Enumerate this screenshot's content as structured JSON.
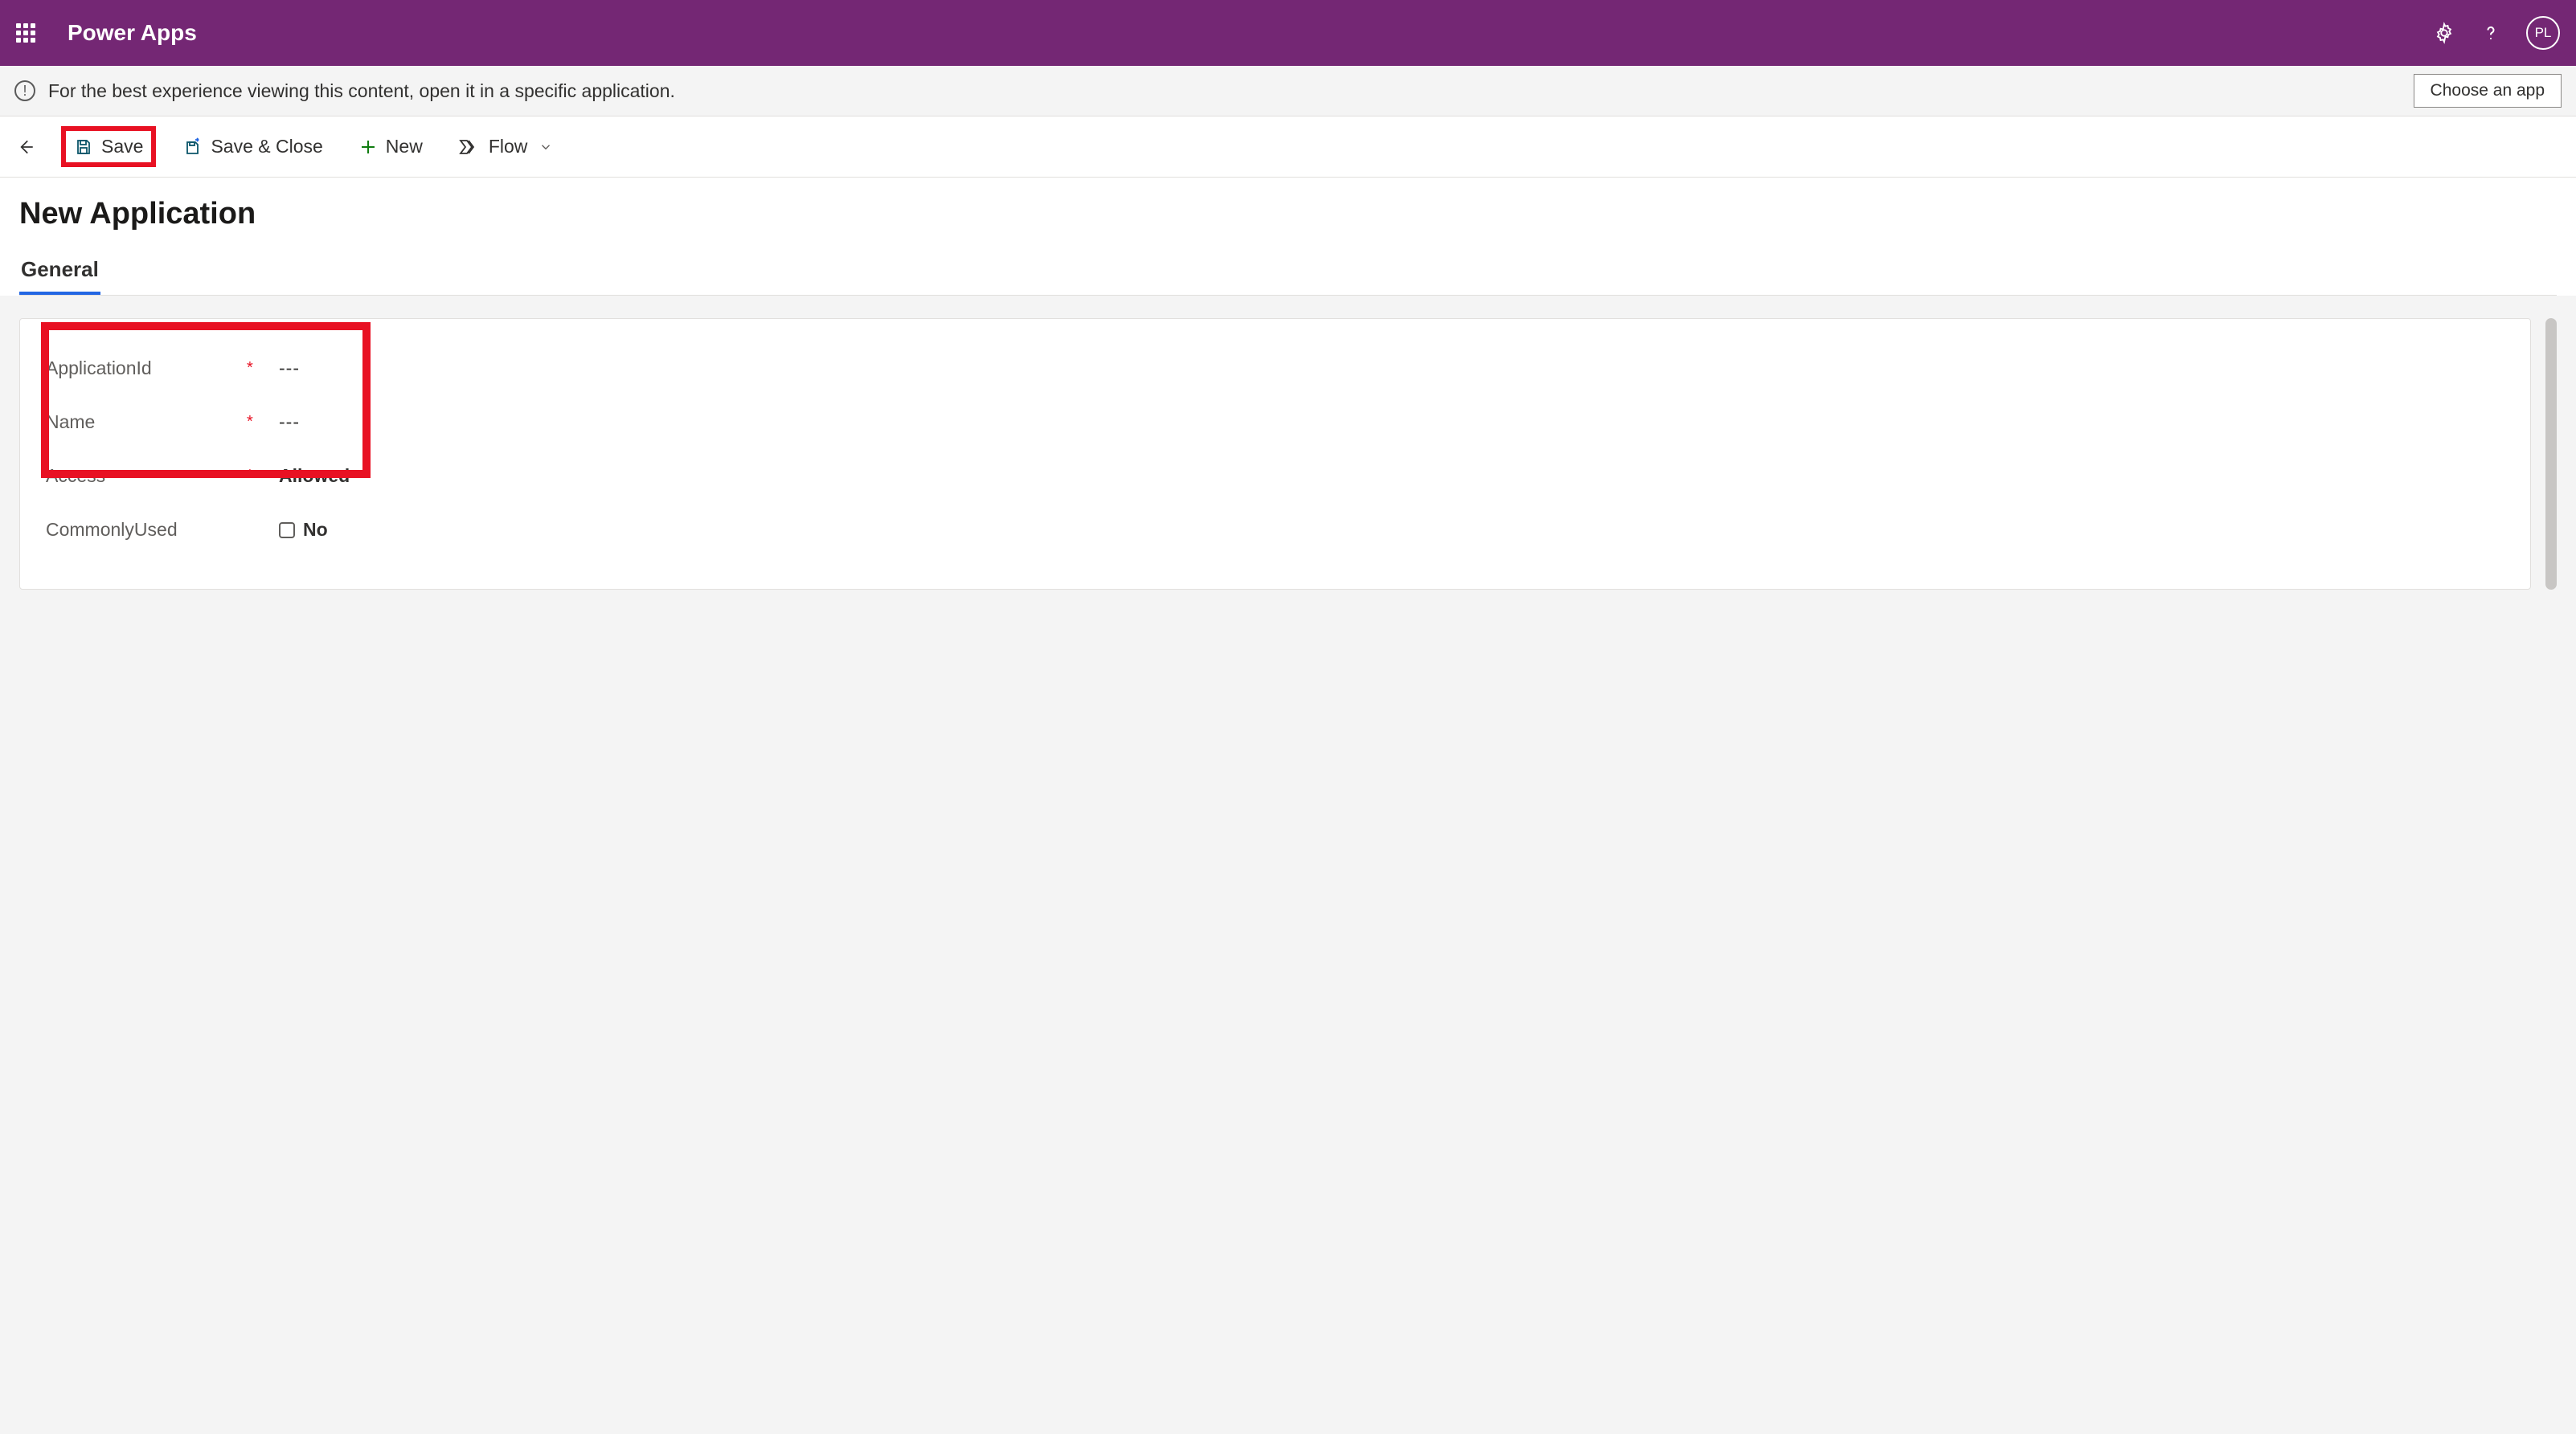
{
  "header": {
    "brand": "Power Apps",
    "avatar_initials": "PL"
  },
  "notice": {
    "text": "For the best experience viewing this content, open it in a specific application.",
    "button_label": "Choose an app"
  },
  "commands": {
    "save": "Save",
    "save_close": "Save & Close",
    "new": "New",
    "flow": "Flow"
  },
  "page": {
    "title": "New Application",
    "tabs": [
      {
        "label": "General",
        "active": true
      }
    ]
  },
  "form": {
    "fields": [
      {
        "label": "ApplicationId",
        "required": true,
        "value": "---",
        "kind": "placeholder"
      },
      {
        "label": "Name",
        "required": true,
        "value": "---",
        "kind": "placeholder"
      },
      {
        "label": "Access",
        "required": true,
        "value": "Allowed",
        "kind": "bold"
      },
      {
        "label": "CommonlyUsed",
        "required": false,
        "value": "No",
        "kind": "checkbox"
      }
    ]
  }
}
